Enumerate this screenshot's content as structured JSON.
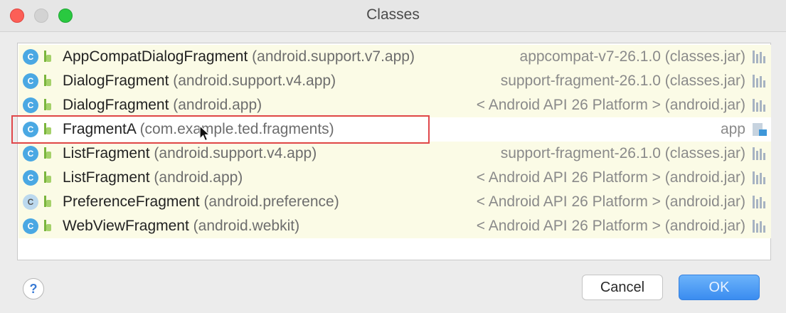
{
  "window": {
    "title": "Classes"
  },
  "rows": [
    {
      "name": "AppCompatDialogFragment",
      "package": "(android.support.v7.app)",
      "library": "appcompat-v7-26.1.0 (classes.jar)",
      "lib_icon": "library-icon",
      "class_icon": "C"
    },
    {
      "name": "DialogFragment",
      "package": "(android.support.v4.app)",
      "library": "support-fragment-26.1.0 (classes.jar)",
      "lib_icon": "library-icon",
      "class_icon": "C"
    },
    {
      "name": "DialogFragment",
      "package": "(android.app)",
      "library": "< Android API 26 Platform > (android.jar)",
      "lib_icon": "library-icon",
      "class_icon": "C"
    },
    {
      "name": "FragmentA",
      "package": "(com.example.ted.fragments)",
      "library": "app",
      "lib_icon": "module-icon",
      "class_icon": "C"
    },
    {
      "name": "ListFragment",
      "package": "(android.support.v4.app)",
      "library": "support-fragment-26.1.0 (classes.jar)",
      "lib_icon": "library-icon",
      "class_icon": "C"
    },
    {
      "name": "ListFragment",
      "package": "(android.app)",
      "library": "< Android API 26 Platform > (android.jar)",
      "lib_icon": "library-icon",
      "class_icon": "C"
    },
    {
      "name": "PreferenceFragment",
      "package": "(android.preference)",
      "library": "< Android API 26 Platform > (android.jar)",
      "lib_icon": "library-icon",
      "class_icon": "C"
    },
    {
      "name": "WebViewFragment",
      "package": "(android.webkit)",
      "library": "< Android API 26 Platform > (android.jar)",
      "lib_icon": "library-icon",
      "class_icon": "C"
    }
  ],
  "footer": {
    "help_label": "?",
    "cancel_label": "Cancel",
    "ok_label": "OK"
  },
  "colors": {
    "row_highlight": "#fbfbe6",
    "selection_outline": "#e0474a",
    "class_icon": "#4aa8e3",
    "ok_button": "#3a8cf0"
  }
}
